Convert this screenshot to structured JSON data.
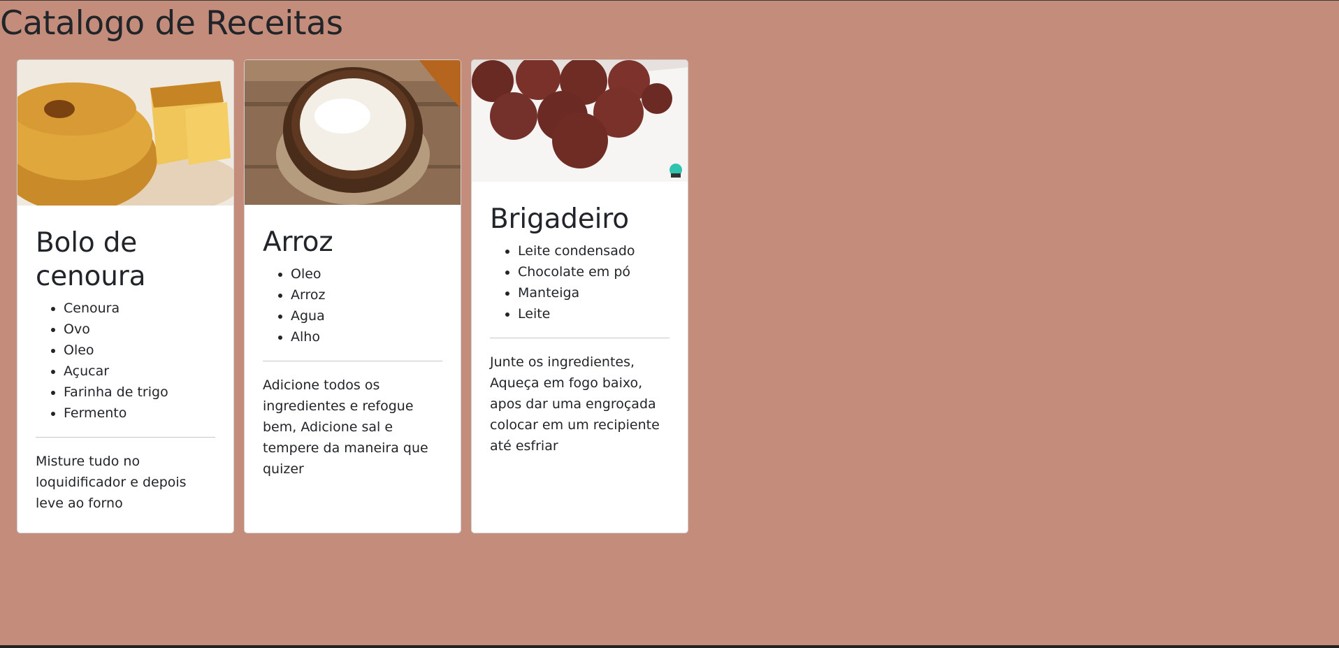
{
  "page": {
    "title": "Catalogo de Receitas"
  },
  "recipes": [
    {
      "title": "Bolo de cenoura",
      "image_icon": "carrot-cake-image",
      "ingredients": [
        "Cenoura",
        "Ovo",
        "Oleo",
        "Açucar",
        "Farinha de trigo",
        "Fermento"
      ],
      "method": "Misture tudo no loquidificador e depois leve ao forno"
    },
    {
      "title": "Arroz",
      "image_icon": "rice-bowl-image",
      "ingredients": [
        "Oleo",
        "Arroz",
        "Agua",
        "Alho"
      ],
      "method": "Adicione todos os ingredientes e refogue bem, Adicione sal e tempere da maneira que quizer"
    },
    {
      "title": "Brigadeiro",
      "image_icon": "brigadeiro-image",
      "ingredients": [
        "Leite condensado",
        "Chocolate em pó",
        "Manteiga",
        "Leite"
      ],
      "method": "Junte os ingredientes, Aqueça em fogo baixo, apos dar uma engroçada colocar em um recipiente até esfriar"
    }
  ],
  "colors": {
    "page_background": "#c48c7a",
    "card_background": "#ffffff",
    "text": "#212529"
  }
}
